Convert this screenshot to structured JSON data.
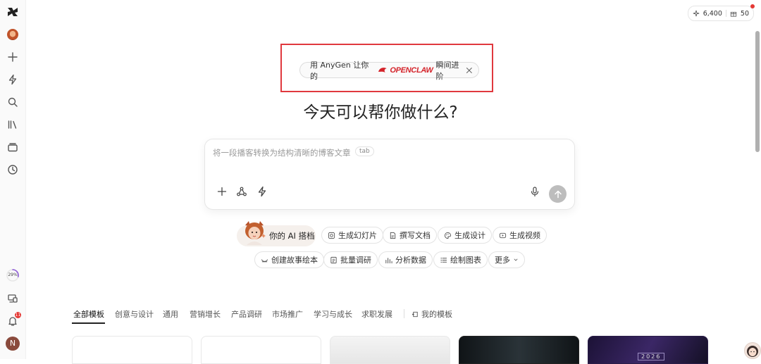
{
  "sidebar": {
    "items": [
      {
        "name": "logo",
        "icon": "anygen-logo-icon"
      },
      {
        "name": "avatar",
        "icon": "avatar-icon"
      },
      {
        "name": "new",
        "icon": "plus-icon"
      },
      {
        "name": "quick",
        "icon": "bolt-icon"
      },
      {
        "name": "search",
        "icon": "search-icon"
      },
      {
        "name": "library",
        "icon": "library-icon"
      },
      {
        "name": "projects",
        "icon": "briefcase-icon"
      },
      {
        "name": "history",
        "icon": "clock-icon"
      }
    ],
    "progress_label": "29%",
    "progress_value": 0.29,
    "notification_count": "11",
    "user_initial": "N"
  },
  "credits": {
    "points": "6,400",
    "gifts": "50"
  },
  "promo": {
    "prefix": "用 AnyGen 让你的",
    "brand": "OPENCLAW",
    "suffix": "瞬间进阶"
  },
  "headline": "今天可以帮你做什么?",
  "prompt": {
    "placeholder": "将一段播客转换为结构清晰的博客文章",
    "tab_hint": "tab"
  },
  "chips_row1": {
    "ai_partner": "你的 AI 搭档",
    "slides": "生成幻灯片",
    "doc": "撰写文档",
    "design": "生成设计",
    "video": "生成视频"
  },
  "chips_row2": {
    "story": "创建故事绘本",
    "research": "批量调研",
    "analysis": "分析数据",
    "chart": "绘制图表",
    "more": "更多"
  },
  "template_tabs": [
    "全部模板",
    "创意与设计",
    "通用",
    "营销增长",
    "产品调研",
    "市场推广",
    "学习与成长",
    "求职发展"
  ],
  "my_templates": "我的模板",
  "cards": {
    "year_text": "2026"
  },
  "colors": {
    "highlight_red": "#e0383e",
    "brand_red": "#d4232a",
    "badge_red": "#e53935"
  }
}
